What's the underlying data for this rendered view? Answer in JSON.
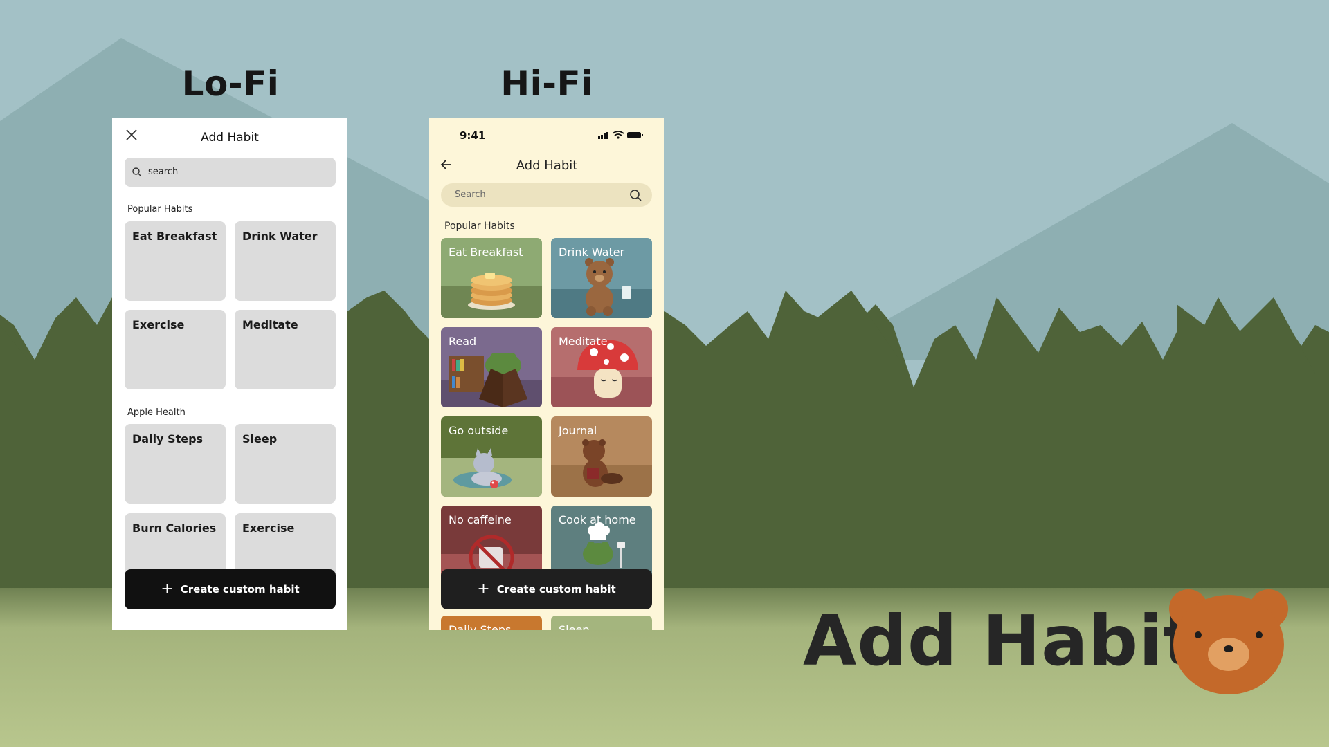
{
  "headings": {
    "lofi": "Lo-Fi",
    "hifi": "Hi-Fi"
  },
  "lofi": {
    "title": "Add Habit",
    "search_placeholder": "search",
    "sections": {
      "popular": "Popular Habits",
      "health": "Apple Health"
    },
    "popular": [
      "Eat Breakfast",
      "Drink Water",
      "Exercise",
      "Meditate"
    ],
    "health": [
      "Daily Steps",
      "Sleep",
      "Burn Calories",
      "Exercise"
    ],
    "cta": "Create custom habit",
    "cta_icon": "plus-icon"
  },
  "hifi": {
    "status_time": "9:41",
    "title": "Add Habit",
    "search_placeholder": "Search",
    "section": "Popular Habits",
    "cards": [
      "Eat Breakfast",
      "Drink Water",
      "Read",
      "Meditate",
      "Go outside",
      "Journal",
      "No caffeine",
      "Cook at home",
      "Daily Steps",
      "Sleep"
    ],
    "cta": "Create custom habit",
    "cta_icon": "plus-icon"
  },
  "footer_title": "Add Habit",
  "colors": {
    "sky": "#a3c1c6",
    "mountain": "#8fb1b3",
    "forest": "#4e6339",
    "meadow": "#b6c48c",
    "bear": "#c4692a",
    "hifi_background": "#fdf6d9"
  }
}
